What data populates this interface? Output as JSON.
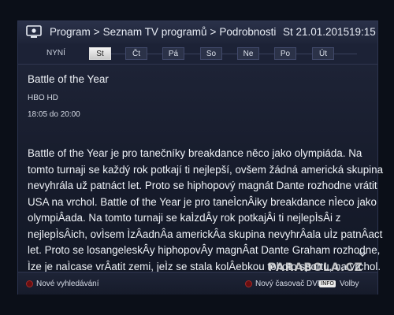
{
  "header": {
    "breadcrumb": [
      "Program",
      "Seznam TV programů",
      "Podrobnosti"
    ],
    "date": "St 21.01.2015",
    "time": "19:15"
  },
  "daybar": {
    "now_label": "NYNÍ",
    "days": [
      "St",
      "Čt",
      "Pá",
      "So",
      "Ne",
      "Po",
      "Út"
    ],
    "selected": "St"
  },
  "program": {
    "title": "Battle of the Year",
    "channel": "HBO HD",
    "timespan": "18:05 do 20:00",
    "description_lines": [
      "Battle of the Year je pro tanečníky breakdance něco jako olympiáda. Na",
      "tomto turnaji se každý rok potkají ti nejlepší, ovšem žádná americká skupina",
      "nevyhrála už patnáct let. Proto se hiphopový magnát Dante rozhodne vrátit",
      "USA na vrchol. Battle of the Year je pro taneÌcnÂiky breakdance nÌeco jako",
      "olympiÂada. Na tomto turnaji se kaÌzdÂy rok potkajÂi ti nejlepÌsÂi z",
      "nejlepÌsÂich, ovÌsem ÌzÂadnÂa americkÂa skupina nevyhrÂala uÌz patnÂact",
      "let. Proto se losangeleskÂy hiphopovÂy magnÂat Dante Graham rozhodne,",
      "Ìze je naÌcase vrÂatit zemi, jeÌz se stala kolÂebkou tohoto sportu, na vrchol."
    ]
  },
  "footer": {
    "new_search": "Nové vyhledávání",
    "new_dvr": "Nový časovač DVR",
    "info_key": "INFO",
    "options": "Volby"
  },
  "watermark": "PARABOLA.CZ",
  "colors": {
    "accent_red": "#a52a2a",
    "selected_day_bg": "#dcdcdc",
    "panel_bg": "#171c2c"
  },
  "icons": {
    "header": "tv-icon",
    "scroll": "chevron-down-icon",
    "button": "red-button-icon"
  }
}
